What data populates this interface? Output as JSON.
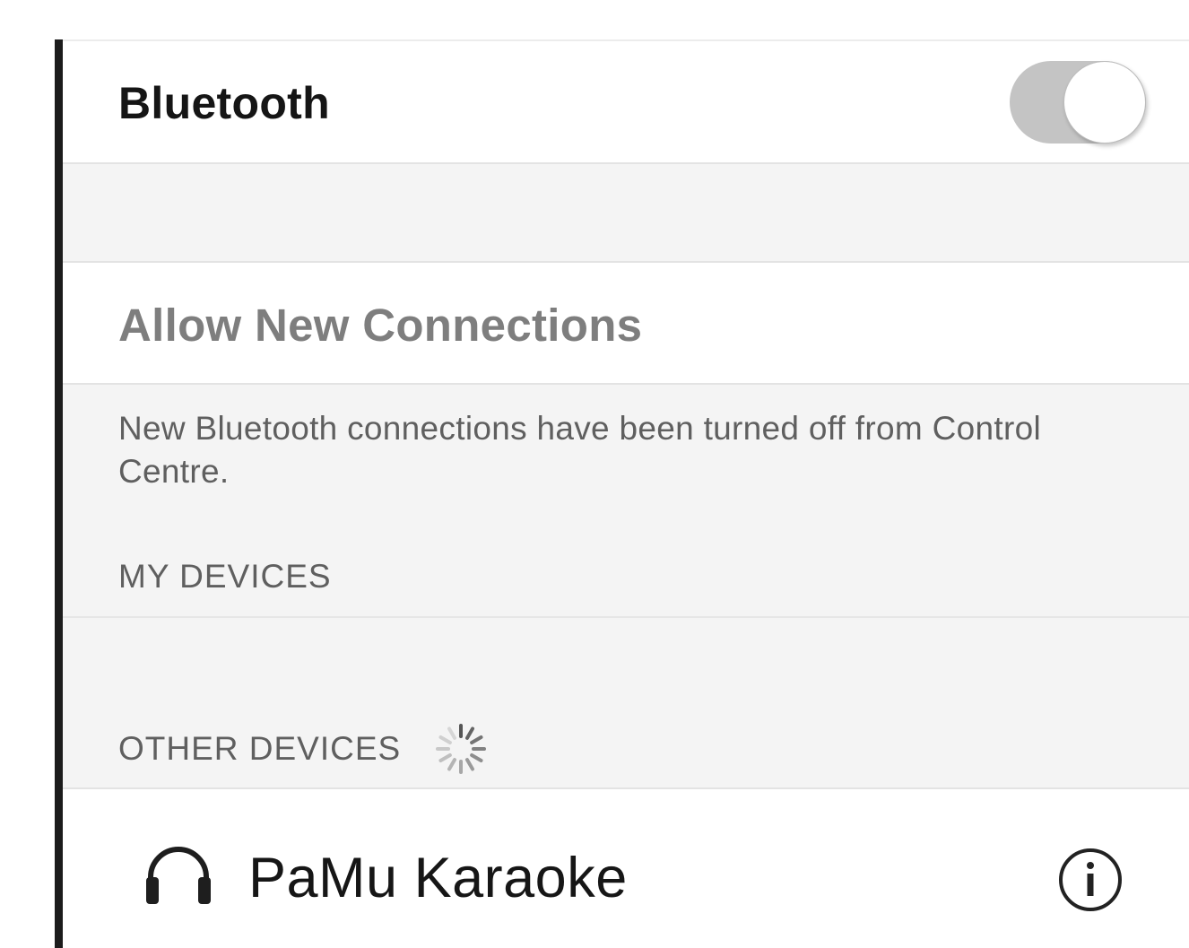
{
  "bluetooth": {
    "label": "Bluetooth",
    "enabled": false
  },
  "allow_new_connections": {
    "label": "Allow New Connections"
  },
  "footnote": "New Bluetooth connections have been turned off from Control Centre.",
  "sections": {
    "my_devices": "MY DEVICES",
    "other_devices": "OTHER DEVICES"
  },
  "other_devices": [
    {
      "name": "PaMu Karaoke",
      "icon": "headphones-icon",
      "accessory_icon": "info-icon"
    }
  ],
  "spinner_icon": "activity-spinner-icon",
  "colors": {
    "toggle_off_track": "#c4c4c4",
    "primary_text": "#151515",
    "secondary_text": "#5f5f5f",
    "disabled_text": "#7e7e7e",
    "grouped_background": "#f4f4f4"
  }
}
